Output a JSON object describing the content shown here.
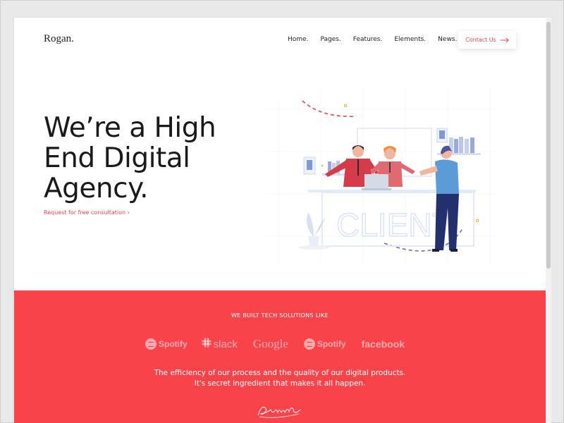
{
  "header": {
    "logo": "Rogan.",
    "nav": [
      "Home.",
      "Pages.",
      "Features.",
      "Elements.",
      "News."
    ],
    "contact_label": "Contact Us"
  },
  "hero": {
    "title_lines": [
      "We’re a High",
      "End Digital",
      "Agency."
    ],
    "cta_link": "Request for free consultation",
    "cta_chevron": "›",
    "illustration_text": "CLIENT"
  },
  "clients": {
    "heading": "WE BUILT TECH SOLUTIONS LIKE",
    "brands": [
      "Spotify",
      "slack",
      "Google",
      "Spotify",
      "facebook"
    ],
    "tagline_lines": [
      "The efficiency of our process and the quality of our digital products.",
      "It's secret ingredient that makes it all happen."
    ],
    "signature": "Amail"
  },
  "colors": {
    "accent": "#f9434a",
    "link": "#f0414b",
    "text": "#1a1a1a"
  },
  "icons": {
    "contact_arrow": "arrow-right-icon",
    "spotify": "spotify-icon",
    "slack": "slack-icon"
  }
}
